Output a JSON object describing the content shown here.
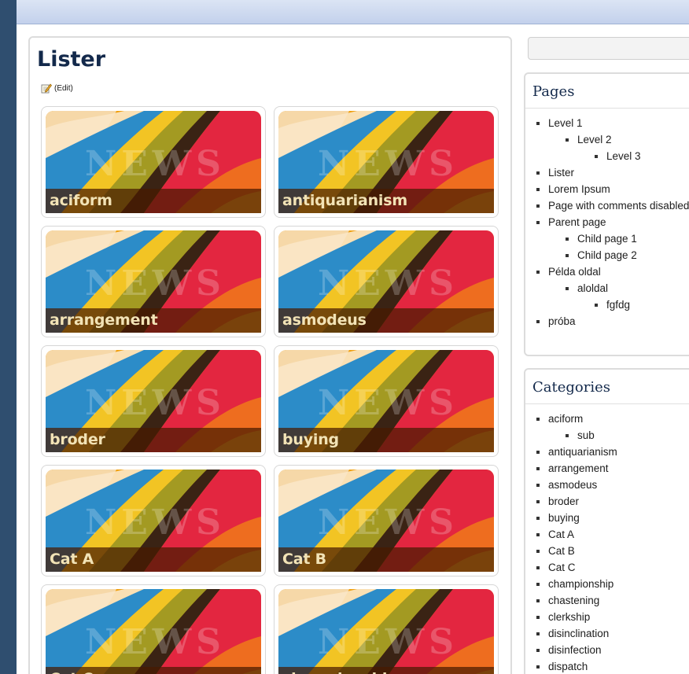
{
  "page": {
    "title": "Lister",
    "edit_label": "(Edit)"
  },
  "cards": [
    {
      "label": "aciform"
    },
    {
      "label": "antiquarianism"
    },
    {
      "label": "arrangement"
    },
    {
      "label": "asmodeus"
    },
    {
      "label": "broder"
    },
    {
      "label": "buying"
    },
    {
      "label": "Cat A"
    },
    {
      "label": "Cat B"
    },
    {
      "label": "Cat C"
    },
    {
      "label": "championship"
    }
  ],
  "thumbnail": {
    "watermark": "NEWS"
  },
  "sidebar": {
    "pages": {
      "title": "Pages",
      "items": [
        {
          "label": ""
        },
        {
          "label": "Level 1"
        },
        {
          "label": "Level 2"
        },
        {
          "label": "Level 3"
        },
        {
          "label": "Lister"
        },
        {
          "label": "Lorem Ipsum"
        },
        {
          "label": "Page with comments disabled"
        },
        {
          "label": "Parent page"
        },
        {
          "label": "Child page 1"
        },
        {
          "label": "Child page 2"
        },
        {
          "label": "Példa oldal"
        },
        {
          "label": "aloldal"
        },
        {
          "label": "fgfdg"
        },
        {
          "label": "próba"
        }
      ]
    },
    "categories": {
      "title": "Categories",
      "items": [
        {
          "label": "aciform"
        },
        {
          "label": "sub"
        },
        {
          "label": "antiquarianism"
        },
        {
          "label": "arrangement"
        },
        {
          "label": "asmodeus"
        },
        {
          "label": "broder"
        },
        {
          "label": "buying"
        },
        {
          "label": "Cat A"
        },
        {
          "label": "Cat B"
        },
        {
          "label": "Cat C"
        },
        {
          "label": "championship"
        },
        {
          "label": "chastening"
        },
        {
          "label": "clerkship"
        },
        {
          "label": "disinclination"
        },
        {
          "label": "disinfection"
        },
        {
          "label": "dispatch"
        }
      ]
    }
  },
  "colors": {
    "title": "#13294b",
    "sidebar_strip": "#2f4e6f",
    "caption_band": "#481a00",
    "caption_text": "#f2e3b6"
  }
}
